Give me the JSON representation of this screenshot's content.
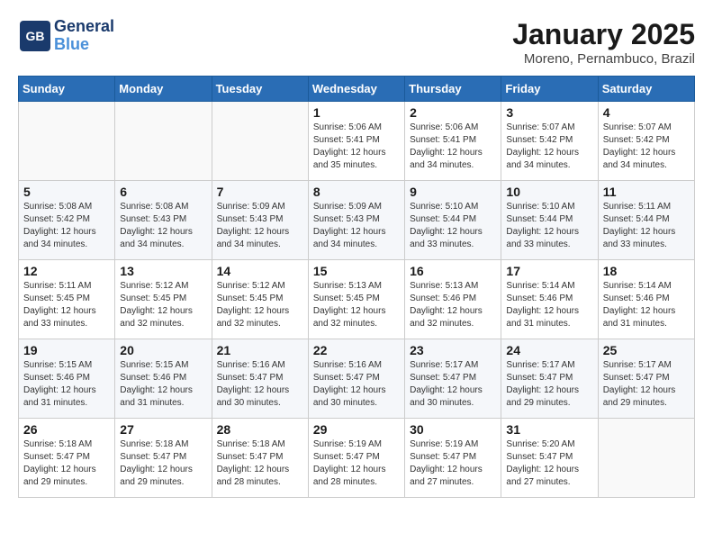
{
  "logo": {
    "line1": "General",
    "line2": "Blue"
  },
  "title": "January 2025",
  "subtitle": "Moreno, Pernambuco, Brazil",
  "days_of_week": [
    "Sunday",
    "Monday",
    "Tuesday",
    "Wednesday",
    "Thursday",
    "Friday",
    "Saturday"
  ],
  "weeks": [
    [
      {
        "day": "",
        "info": ""
      },
      {
        "day": "",
        "info": ""
      },
      {
        "day": "",
        "info": ""
      },
      {
        "day": "1",
        "info": "Sunrise: 5:06 AM\nSunset: 5:41 PM\nDaylight: 12 hours\nand 35 minutes."
      },
      {
        "day": "2",
        "info": "Sunrise: 5:06 AM\nSunset: 5:41 PM\nDaylight: 12 hours\nand 34 minutes."
      },
      {
        "day": "3",
        "info": "Sunrise: 5:07 AM\nSunset: 5:42 PM\nDaylight: 12 hours\nand 34 minutes."
      },
      {
        "day": "4",
        "info": "Sunrise: 5:07 AM\nSunset: 5:42 PM\nDaylight: 12 hours\nand 34 minutes."
      }
    ],
    [
      {
        "day": "5",
        "info": "Sunrise: 5:08 AM\nSunset: 5:42 PM\nDaylight: 12 hours\nand 34 minutes."
      },
      {
        "day": "6",
        "info": "Sunrise: 5:08 AM\nSunset: 5:43 PM\nDaylight: 12 hours\nand 34 minutes."
      },
      {
        "day": "7",
        "info": "Sunrise: 5:09 AM\nSunset: 5:43 PM\nDaylight: 12 hours\nand 34 minutes."
      },
      {
        "day": "8",
        "info": "Sunrise: 5:09 AM\nSunset: 5:43 PM\nDaylight: 12 hours\nand 34 minutes."
      },
      {
        "day": "9",
        "info": "Sunrise: 5:10 AM\nSunset: 5:44 PM\nDaylight: 12 hours\nand 33 minutes."
      },
      {
        "day": "10",
        "info": "Sunrise: 5:10 AM\nSunset: 5:44 PM\nDaylight: 12 hours\nand 33 minutes."
      },
      {
        "day": "11",
        "info": "Sunrise: 5:11 AM\nSunset: 5:44 PM\nDaylight: 12 hours\nand 33 minutes."
      }
    ],
    [
      {
        "day": "12",
        "info": "Sunrise: 5:11 AM\nSunset: 5:45 PM\nDaylight: 12 hours\nand 33 minutes."
      },
      {
        "day": "13",
        "info": "Sunrise: 5:12 AM\nSunset: 5:45 PM\nDaylight: 12 hours\nand 32 minutes."
      },
      {
        "day": "14",
        "info": "Sunrise: 5:12 AM\nSunset: 5:45 PM\nDaylight: 12 hours\nand 32 minutes."
      },
      {
        "day": "15",
        "info": "Sunrise: 5:13 AM\nSunset: 5:45 PM\nDaylight: 12 hours\nand 32 minutes."
      },
      {
        "day": "16",
        "info": "Sunrise: 5:13 AM\nSunset: 5:46 PM\nDaylight: 12 hours\nand 32 minutes."
      },
      {
        "day": "17",
        "info": "Sunrise: 5:14 AM\nSunset: 5:46 PM\nDaylight: 12 hours\nand 31 minutes."
      },
      {
        "day": "18",
        "info": "Sunrise: 5:14 AM\nSunset: 5:46 PM\nDaylight: 12 hours\nand 31 minutes."
      }
    ],
    [
      {
        "day": "19",
        "info": "Sunrise: 5:15 AM\nSunset: 5:46 PM\nDaylight: 12 hours\nand 31 minutes."
      },
      {
        "day": "20",
        "info": "Sunrise: 5:15 AM\nSunset: 5:46 PM\nDaylight: 12 hours\nand 31 minutes."
      },
      {
        "day": "21",
        "info": "Sunrise: 5:16 AM\nSunset: 5:47 PM\nDaylight: 12 hours\nand 30 minutes."
      },
      {
        "day": "22",
        "info": "Sunrise: 5:16 AM\nSunset: 5:47 PM\nDaylight: 12 hours\nand 30 minutes."
      },
      {
        "day": "23",
        "info": "Sunrise: 5:17 AM\nSunset: 5:47 PM\nDaylight: 12 hours\nand 30 minutes."
      },
      {
        "day": "24",
        "info": "Sunrise: 5:17 AM\nSunset: 5:47 PM\nDaylight: 12 hours\nand 29 minutes."
      },
      {
        "day": "25",
        "info": "Sunrise: 5:17 AM\nSunset: 5:47 PM\nDaylight: 12 hours\nand 29 minutes."
      }
    ],
    [
      {
        "day": "26",
        "info": "Sunrise: 5:18 AM\nSunset: 5:47 PM\nDaylight: 12 hours\nand 29 minutes."
      },
      {
        "day": "27",
        "info": "Sunrise: 5:18 AM\nSunset: 5:47 PM\nDaylight: 12 hours\nand 29 minutes."
      },
      {
        "day": "28",
        "info": "Sunrise: 5:18 AM\nSunset: 5:47 PM\nDaylight: 12 hours\nand 28 minutes."
      },
      {
        "day": "29",
        "info": "Sunrise: 5:19 AM\nSunset: 5:47 PM\nDaylight: 12 hours\nand 28 minutes."
      },
      {
        "day": "30",
        "info": "Sunrise: 5:19 AM\nSunset: 5:47 PM\nDaylight: 12 hours\nand 27 minutes."
      },
      {
        "day": "31",
        "info": "Sunrise: 5:20 AM\nSunset: 5:47 PM\nDaylight: 12 hours\nand 27 minutes."
      },
      {
        "day": "",
        "info": ""
      }
    ]
  ]
}
